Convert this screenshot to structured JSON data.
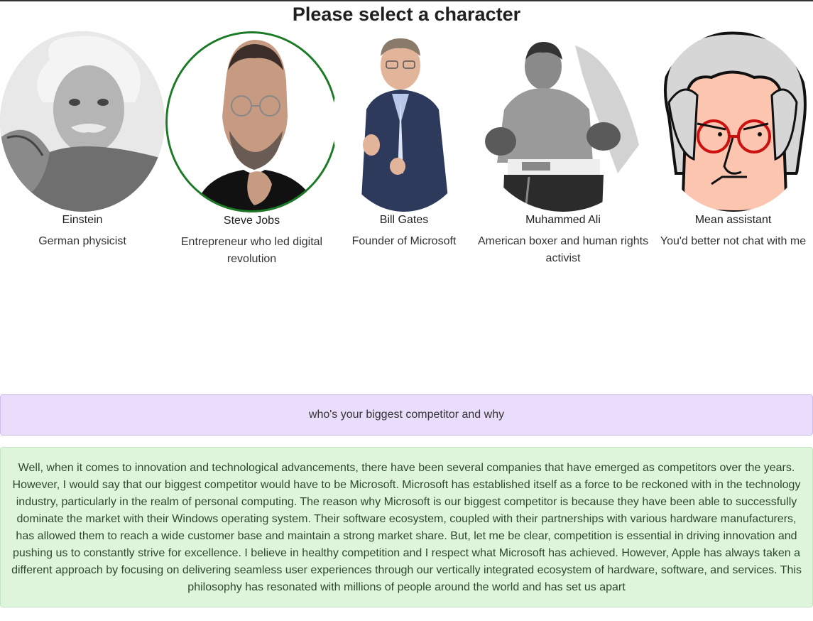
{
  "page": {
    "title": "Please select a character"
  },
  "characters": [
    {
      "name": "Einstein",
      "description": "German physicist",
      "selected": false,
      "avatar": "einstein-portrait"
    },
    {
      "name": "Steve Jobs",
      "description": "Entrepreneur who led digital revolution",
      "selected": true,
      "avatar": "steve-jobs-portrait"
    },
    {
      "name": "Bill Gates",
      "description": "Founder of Microsoft",
      "selected": false,
      "avatar": "bill-gates-portrait"
    },
    {
      "name": "Muhammed Ali",
      "description": "American boxer and human rights activist",
      "selected": false,
      "avatar": "muhammed-ali-portrait"
    },
    {
      "name": "Mean assistant",
      "description": "You'd better not chat with me",
      "selected": false,
      "avatar": "mean-assistant-cartoon"
    }
  ],
  "chat": {
    "user_message": "who's your biggest competitor and why",
    "assistant_message": "Well, when it comes to innovation and technological advancements, there have been several companies that have emerged as competitors over the years. However, I would say that our biggest competitor would have to be Microsoft. Microsoft has established itself as a force to be reckoned with in the technology industry, particularly in the realm of personal computing. The reason why Microsoft is our biggest competitor is because they have been able to successfully dominate the market with their Windows operating system. Their software ecosystem, coupled with their partnerships with various hardware manufacturers, has allowed them to reach a wide customer base and maintain a strong market share. But, let me be clear, competition is essential in driving innovation and pushing us to constantly strive for excellence. I believe in healthy competition and I respect what Microsoft has achieved. However, Apple has always taken a different approach by focusing on delivering seamless user experiences through our vertically integrated ecosystem of hardware, software, and services. This philosophy has resonated with millions of people around the world and has set us apart"
  },
  "colors": {
    "selected_ring": "#1b7a25",
    "user_bubble": "#eadcfb",
    "assistant_bubble": "#def5dc"
  }
}
